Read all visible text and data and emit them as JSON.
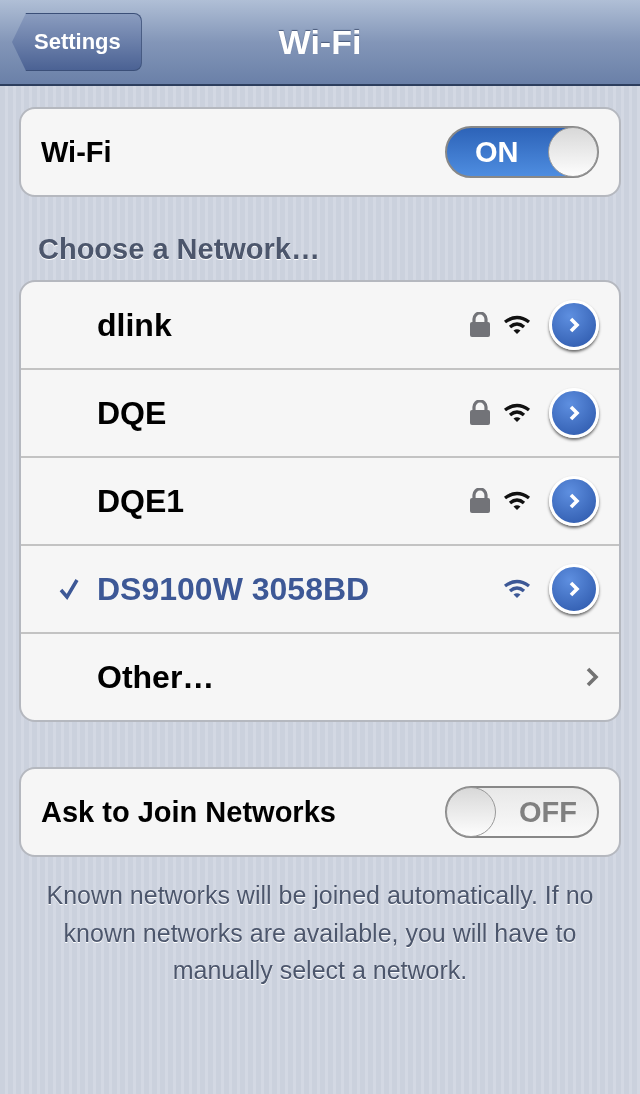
{
  "nav_bar": {
    "back_button": "Settings",
    "title": "Wi-Fi"
  },
  "wifi_row": {
    "label": "Wi-Fi",
    "switch": {
      "text": "ON",
      "on": true
    }
  },
  "section_header": "Choose a Network…",
  "networks": [
    {
      "kind": "network",
      "name": "dlink",
      "secured": true,
      "selected": false
    },
    {
      "kind": "network",
      "name": "DQE",
      "secured": true,
      "selected": false
    },
    {
      "kind": "network",
      "name": "DQE1",
      "secured": true,
      "selected": false
    },
    {
      "kind": "network",
      "name": "DS9100W 3058BD",
      "secured": false,
      "selected": true
    },
    {
      "kind": "other",
      "name": "Other…",
      "selected": false
    }
  ],
  "ask_row": {
    "label": "Ask to Join Networks",
    "switch": {
      "text": "OFF",
      "on": false
    }
  },
  "footer": "Known networks will be joined automatically. If no known networks are available, you will have to manually select a network."
}
